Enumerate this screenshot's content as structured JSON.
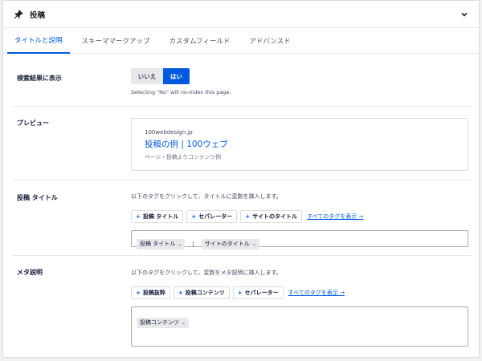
{
  "header": {
    "title": "投稿"
  },
  "tabs": [
    {
      "label": "タイトルと説明"
    },
    {
      "label": "スキーママークアップ"
    },
    {
      "label": "カスタムフィールド"
    },
    {
      "label": "アドバンスド"
    }
  ],
  "search_visibility": {
    "label": "検索結果に表示",
    "no_label": "いいえ",
    "yes_label": "はい",
    "hint": "Selecting \"No\" will no-index this page."
  },
  "preview": {
    "label": "プレビュー",
    "url": "100webdesign.jp",
    "title": "投稿の例 | 100ウェブ",
    "description": "ページ・投稿よりコンテンツ例"
  },
  "post_title": {
    "label": "投稿 タイトル",
    "instruction": "以下のタグをクリックして、タイトルに変数を挿入します。",
    "tags": [
      "投稿 タイトル",
      "セパレーター",
      "サイトのタイトル"
    ],
    "show_all": "すべてのタグを表示 →",
    "field_chips": [
      "投稿 タイトル",
      "サイトのタイトル"
    ],
    "separator": "|"
  },
  "meta_description": {
    "label": "メタ説明",
    "instruction": "以下のタグをクリックして、変数をメタ説明に挿入します。",
    "tags": [
      "投稿抜粋",
      "投稿コンテンツ",
      "セパレーター"
    ],
    "show_all": "すべてのタグを表示 →",
    "field_chips": [
      "投稿コンテンツ"
    ]
  },
  "colors": {
    "accent": "#005ae0",
    "text": "#141b38",
    "border": "#dcdcde"
  },
  "icons": {
    "header": "pin-icon",
    "collapse": "chevron-down-icon"
  }
}
